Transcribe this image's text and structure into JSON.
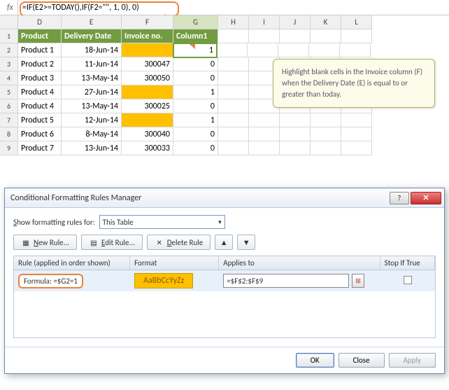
{
  "formula_bar": {
    "fx": "fx",
    "text": "=IF(E2>=TODAY(),IF(F2=\"\", 1, 0), 0)"
  },
  "columns": [
    "D",
    "E",
    "F",
    "G",
    "H",
    "I",
    "J",
    "K",
    "L"
  ],
  "active_column": "G",
  "headers": {
    "D": "Product",
    "E": "Delivery Date",
    "F": "Invoice no.",
    "G": "Column1"
  },
  "active_cell": {
    "row": 2,
    "col": "G"
  },
  "rows": [
    {
      "n": 2,
      "D": "Product 1",
      "E": "18-Jun-14",
      "F": "",
      "F_hl": true,
      "G": "1",
      "G_active": true
    },
    {
      "n": 3,
      "D": "Product 2",
      "E": "11-Jun-14",
      "F": "300047",
      "F_hl": false,
      "G": "0"
    },
    {
      "n": 4,
      "D": "Product 3",
      "E": "13-May-14",
      "F": "300050",
      "F_hl": false,
      "G": "0"
    },
    {
      "n": 5,
      "D": "Product 4",
      "E": "27-Jun-14",
      "F": "",
      "F_hl": true,
      "G": "1"
    },
    {
      "n": 6,
      "D": "Product 4",
      "E": "13-May-14",
      "F": "300025",
      "F_hl": false,
      "G": "0"
    },
    {
      "n": 7,
      "D": "Product 5",
      "E": "12-Jun-14",
      "F": "",
      "F_hl": true,
      "G": "1"
    },
    {
      "n": 8,
      "D": "Product 6",
      "E": "8-May-14",
      "F": "300040",
      "F_hl": false,
      "G": "0"
    },
    {
      "n": 9,
      "D": "Product 7",
      "E": "13-Jun-14",
      "F": "300033",
      "F_hl": false,
      "G": "0"
    }
  ],
  "callout": "Highlight blank cells in the Invoice column (F) when the Delivery Date (E) is equal to or greater than today.",
  "dialog": {
    "title": "Conditional Formatting Rules Manager",
    "show_label": "Show formatting rules for:",
    "show_value": "This Table",
    "btn_new": "New Rule...",
    "btn_edit": "Edit Rule...",
    "btn_delete": "Delete Rule",
    "head_rule": "Rule (applied in order shown)",
    "head_format": "Format",
    "head_applies": "Applies to",
    "head_stop": "Stop If True",
    "rule_text": "Formula: =$G2=1",
    "format_preview": "AaBbCcYyZz",
    "applies_to": "=$F$2:$F$9",
    "ok": "OK",
    "close": "Close",
    "apply": "Apply"
  }
}
